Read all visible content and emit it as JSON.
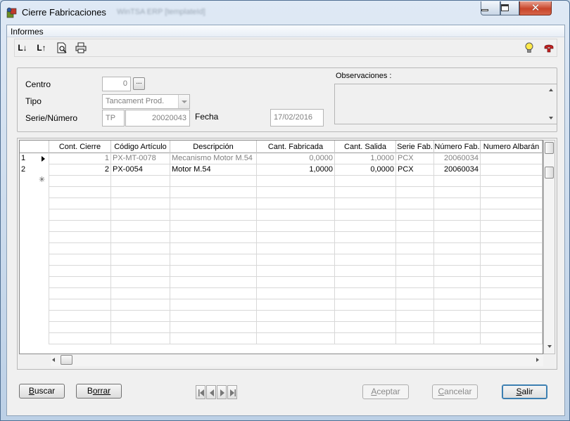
{
  "window": {
    "title": "Cierre Fabricaciones",
    "title_extra": "WinTSA ERP [templateId]"
  },
  "menu": {
    "informes": "Informes"
  },
  "toolbar": {
    "sort_asc": "L↓",
    "sort_desc": "L↑"
  },
  "form": {
    "centro_label": "Centro",
    "centro_value": "0",
    "ellipsis": "...",
    "tipo_label": "Tipo",
    "tipo_value": "Tancament Prod.",
    "serie_label": "Serie/Número",
    "serie_value": "TP",
    "numero_value": "20020043",
    "fecha_label": "Fecha",
    "fecha_value": "17/02/2016",
    "observaciones_label": "Observaciones :"
  },
  "grid": {
    "columns": [
      "",
      "Cont. Cierre",
      "Código Artículo",
      "Descripción",
      "Cant. Fabricada",
      "Cant. Salida",
      "Serie Fab.",
      "Número Fab.",
      "Numero Albarán"
    ],
    "rows": [
      {
        "row": "1",
        "cont": "1",
        "codigo": "PX-MT-0078",
        "desc": "Mecanismo Motor M.54",
        "fab": "0,0000",
        "salida": "1,0000",
        "serie": "PCX",
        "numero": "20060034",
        "albaran": ""
      },
      {
        "row": "2",
        "cont": "2",
        "codigo": "PX-0054",
        "desc": "Motor M.54",
        "fab": "1,0000",
        "salida": "0,0000",
        "serie": "PCX",
        "numero": "20060034",
        "albaran": ""
      }
    ]
  },
  "buttons": {
    "buscar_pre": "B",
    "buscar_post": "uscar",
    "borrar_pre": "B",
    "borrar_post": "orrar",
    "aceptar_pre": "A",
    "aceptar_post": "ceptar",
    "cancelar_pre": "C",
    "cancelar_post": "ancelar",
    "salir_pre": "S",
    "salir_post": "alir"
  },
  "icons": {
    "app": "app-icon",
    "preview": "print-preview-icon",
    "print": "printer-icon",
    "help": "lightbulb-icon",
    "support": "support-icon"
  }
}
